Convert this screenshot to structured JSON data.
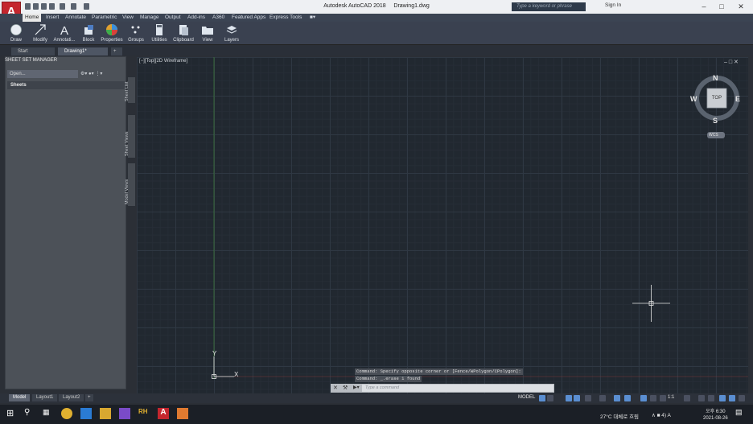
{
  "app": {
    "title": "Autodesk AutoCAD 2018",
    "document": "Drawing1.dwg",
    "logo_letter": "A"
  },
  "search": {
    "placeholder": "Type a keyword or phrase"
  },
  "account": {
    "signin_label": "Sign In"
  },
  "ribbon_tabs": [
    "Home",
    "Insert",
    "Annotate",
    "Parametric",
    "View",
    "Manage",
    "Output",
    "Add-ins",
    "A360",
    "Featured Apps",
    "Express Tools"
  ],
  "ribbon_panels": [
    "Draw",
    "Modify",
    "Annotati...",
    "Block",
    "Properties",
    "Groups",
    "Utilities",
    "Clipboard",
    "View",
    "Layers"
  ],
  "file_tabs": [
    "Start",
    "Drawing1*"
  ],
  "sheet_set": {
    "title": "SHEET SET MANAGER",
    "select_value": "Open...",
    "sheets_header": "Sheets",
    "vertical_tabs": [
      "Sheet List",
      "Sheet Views",
      "Model Views"
    ]
  },
  "viewport": {
    "label": "[−][Top][2D Wireframe]"
  },
  "viewcube": {
    "north": "N",
    "south": "S",
    "east": "E",
    "west": "W",
    "face": "TOP",
    "ucs": "WCS"
  },
  "ucs_icon": {
    "x": "X",
    "y": "Y"
  },
  "command": {
    "history": [
      "Command: Specify opposite corner or [Fence/WPolygon/CPolygon]:",
      "Command: _.erase 1 found"
    ],
    "placeholder": "Type a command"
  },
  "layout_tabs": [
    "Model",
    "Layout1",
    "Layout2"
  ],
  "status": {
    "model": "MODEL",
    "scale": "1:1"
  },
  "taskbar": {
    "weather": "27°C 대체로 흐림",
    "tray": "∧ ■ 4) A",
    "time": "오후 6:30",
    "date": "2021-08-26"
  },
  "colors": {
    "accent_red": "#c4262e",
    "canvas_bg": "#212830",
    "ribbon_bg": "#3a4150",
    "status_blue": "#5a8ed1"
  }
}
